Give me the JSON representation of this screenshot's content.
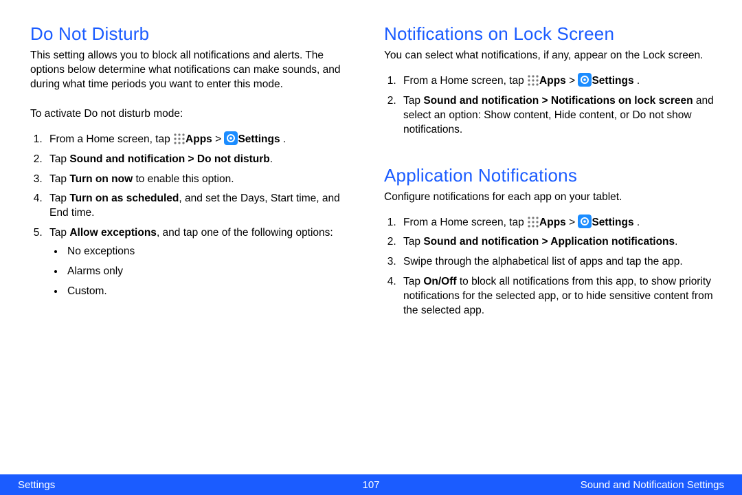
{
  "footer": {
    "left": "Settings",
    "page": "107",
    "right": "Sound and Notification Settings"
  },
  "nav": {
    "home_prefix": "From a Home screen, tap ",
    "apps_label": "Apps",
    "gt": " > ",
    "settings_label": "Settings",
    "period": " ."
  },
  "left": {
    "dnd": {
      "heading": "Do Not Disturb",
      "intro": "This setting allows you to block all notifications and alerts. The options below determine what notifications can make sounds, and during what time periods you want to enter this mode.",
      "activate": "To activate Do not disturb mode:",
      "step2_prefix": "Tap ",
      "step2_bold": "Sound and notification > Do not disturb",
      "step2_suffix": ".",
      "step3_prefix": "Tap ",
      "step3_bold": "Turn on now",
      "step3_suffix": " to enable this option.",
      "step4_prefix": "Tap ",
      "step4_bold": "Turn on as scheduled",
      "step4_suffix": ", and set the Days, Start time, and End time.",
      "step5_prefix": "Tap ",
      "step5_bold": "Allow exceptions",
      "step5_suffix": ", and tap one of the following options:",
      "bullets": {
        "b1": "No exceptions",
        "b2": "Alarms only",
        "b3": "Custom."
      }
    }
  },
  "right": {
    "lock": {
      "heading": "Notifications on Lock Screen",
      "intro": "You can select what notifications, if any, appear on the Lock screen.",
      "step2_prefix": "Tap ",
      "step2_bold": "Sound and notification > Notifications on lock screen",
      "step2_suffix": " and select an option: Show content, Hide content, or Do not show notifications."
    },
    "app": {
      "heading": "Application Notifications",
      "intro": "Configure notifications for each app on your tablet.",
      "step2_prefix": "Tap ",
      "step2_bold": "Sound and notification > Application notifications",
      "step2_suffix": ".",
      "step3": "Swipe through the alphabetical list of apps and tap the app.",
      "step4_prefix": "Tap ",
      "step4_bold": "On/Off",
      "step4_suffix": " to block all notifications from this app, to show priority notifications for the selected app, or to hide sensitive content from the selected app."
    }
  }
}
